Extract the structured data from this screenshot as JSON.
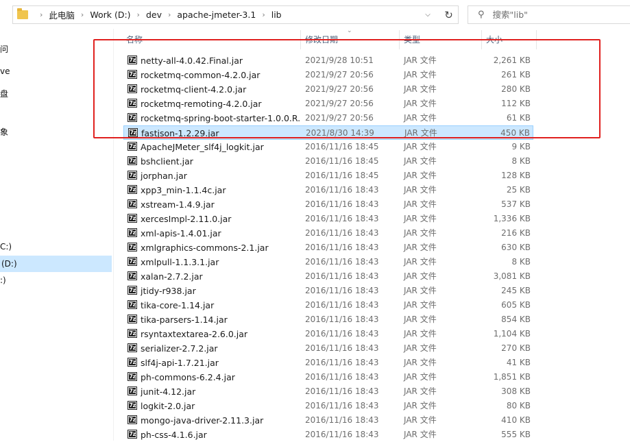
{
  "address_bar": {
    "breadcrumbs": [
      "此电脑",
      "Work (D:)",
      "dev",
      "apache-jmeter-3.1",
      "lib"
    ],
    "dropdown_icon": "chevron-down-icon",
    "refresh_icon": "refresh-icon"
  },
  "search": {
    "placeholder": "搜索\"lib\"",
    "icon": "search-icon"
  },
  "nav": {
    "items": [
      {
        "label": "问",
        "selected": false
      },
      {
        "label": "ve",
        "selected": false
      },
      {
        "label": "盘",
        "selected": false
      },
      {
        "label": "象",
        "selected": false
      },
      {
        "label": "C:)",
        "selected": false
      },
      {
        "label": "(D:)",
        "selected": true
      },
      {
        "label": ":)",
        "selected": false
      }
    ]
  },
  "columns": {
    "name": "名称",
    "date": "修改日期",
    "type": "类型",
    "size": "大小"
  },
  "files": [
    {
      "name": "netty-all-4.0.42.Final.jar",
      "date": "2021/9/28 10:51",
      "type": "JAR 文件",
      "size": "2,261 KB",
      "selected": false
    },
    {
      "name": "rocketmq-common-4.2.0.jar",
      "date": "2021/9/27 20:56",
      "type": "JAR 文件",
      "size": "261 KB",
      "selected": false
    },
    {
      "name": "rocketmq-client-4.2.0.jar",
      "date": "2021/9/27 20:56",
      "type": "JAR 文件",
      "size": "280 KB",
      "selected": false
    },
    {
      "name": "rocketmq-remoting-4.2.0.jar",
      "date": "2021/9/27 20:56",
      "type": "JAR 文件",
      "size": "112 KB",
      "selected": false
    },
    {
      "name": "rocketmq-spring-boot-starter-1.0.0.R...",
      "date": "2021/9/27 20:56",
      "type": "JAR 文件",
      "size": "61 KB",
      "selected": false
    },
    {
      "name": "fastjson-1.2.29.jar",
      "date": "2021/8/30 14:39",
      "type": "JAR 文件",
      "size": "450 KB",
      "selected": true
    },
    {
      "name": "ApacheJMeter_slf4j_logkit.jar",
      "date": "2016/11/16 18:45",
      "type": "JAR 文件",
      "size": "9 KB",
      "selected": false
    },
    {
      "name": "bshclient.jar",
      "date": "2016/11/16 18:45",
      "type": "JAR 文件",
      "size": "8 KB",
      "selected": false
    },
    {
      "name": "jorphan.jar",
      "date": "2016/11/16 18:45",
      "type": "JAR 文件",
      "size": "128 KB",
      "selected": false
    },
    {
      "name": "xpp3_min-1.1.4c.jar",
      "date": "2016/11/16 18:43",
      "type": "JAR 文件",
      "size": "25 KB",
      "selected": false
    },
    {
      "name": "xstream-1.4.9.jar",
      "date": "2016/11/16 18:43",
      "type": "JAR 文件",
      "size": "537 KB",
      "selected": false
    },
    {
      "name": "xercesImpl-2.11.0.jar",
      "date": "2016/11/16 18:43",
      "type": "JAR 文件",
      "size": "1,336 KB",
      "selected": false
    },
    {
      "name": "xml-apis-1.4.01.jar",
      "date": "2016/11/16 18:43",
      "type": "JAR 文件",
      "size": "216 KB",
      "selected": false
    },
    {
      "name": "xmlgraphics-commons-2.1.jar",
      "date": "2016/11/16 18:43",
      "type": "JAR 文件",
      "size": "630 KB",
      "selected": false
    },
    {
      "name": "xmlpull-1.1.3.1.jar",
      "date": "2016/11/16 18:43",
      "type": "JAR 文件",
      "size": "8 KB",
      "selected": false
    },
    {
      "name": "xalan-2.7.2.jar",
      "date": "2016/11/16 18:43",
      "type": "JAR 文件",
      "size": "3,081 KB",
      "selected": false
    },
    {
      "name": "jtidy-r938.jar",
      "date": "2016/11/16 18:43",
      "type": "JAR 文件",
      "size": "245 KB",
      "selected": false
    },
    {
      "name": "tika-core-1.14.jar",
      "date": "2016/11/16 18:43",
      "type": "JAR 文件",
      "size": "605 KB",
      "selected": false
    },
    {
      "name": "tika-parsers-1.14.jar",
      "date": "2016/11/16 18:43",
      "type": "JAR 文件",
      "size": "854 KB",
      "selected": false
    },
    {
      "name": "rsyntaxtextarea-2.6.0.jar",
      "date": "2016/11/16 18:43",
      "type": "JAR 文件",
      "size": "1,104 KB",
      "selected": false
    },
    {
      "name": "serializer-2.7.2.jar",
      "date": "2016/11/16 18:43",
      "type": "JAR 文件",
      "size": "270 KB",
      "selected": false
    },
    {
      "name": "slf4j-api-1.7.21.jar",
      "date": "2016/11/16 18:43",
      "type": "JAR 文件",
      "size": "41 KB",
      "selected": false
    },
    {
      "name": "ph-commons-6.2.4.jar",
      "date": "2016/11/16 18:43",
      "type": "JAR 文件",
      "size": "1,851 KB",
      "selected": false
    },
    {
      "name": "junit-4.12.jar",
      "date": "2016/11/16 18:43",
      "type": "JAR 文件",
      "size": "308 KB",
      "selected": false
    },
    {
      "name": "logkit-2.0.jar",
      "date": "2016/11/16 18:43",
      "type": "JAR 文件",
      "size": "80 KB",
      "selected": false
    },
    {
      "name": "mongo-java-driver-2.11.3.jar",
      "date": "2016/11/16 18:43",
      "type": "JAR 文件",
      "size": "410 KB",
      "selected": false
    },
    {
      "name": "ph-css-4.1.6.jar",
      "date": "2016/11/16 18:43",
      "type": "JAR 文件",
      "size": "555 KB",
      "selected": false
    }
  ],
  "file_icon_label": "7z",
  "annotation_color": "#e0201e"
}
